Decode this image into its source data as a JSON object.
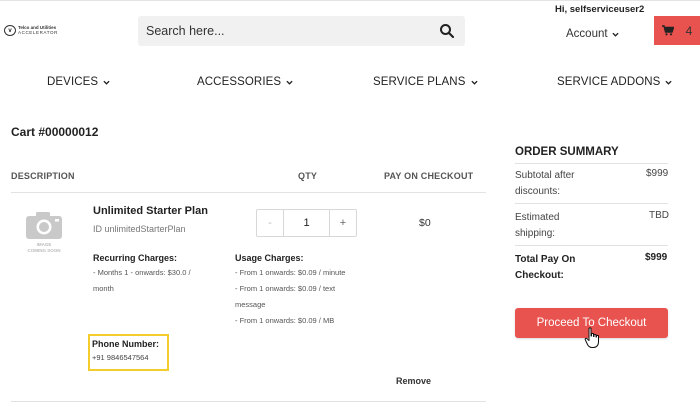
{
  "header": {
    "logo_line1": "Telco and Utilities",
    "logo_line2": "ACCELERATOR",
    "search_placeholder": "Search here...",
    "greeting": "Hi, selfserviceuser2",
    "account_label": "Account",
    "cart_count": "4",
    "accent_color": "#e8534f"
  },
  "nav": [
    "DEVICES",
    "ACCESSORIES",
    "SERVICE PLANS",
    "SERVICE ADDONS"
  ],
  "cart": {
    "title": "Cart #00000012",
    "columns": {
      "description": "DESCRIPTION",
      "qty": "QTY",
      "pay": "PAY ON CHECKOUT"
    },
    "item": {
      "image_caption_1": "IMAGE",
      "image_caption_2": "COMING SOON",
      "name": "Unlimited Starter Plan",
      "id": "ID unlimitedStarterPlan",
      "qty_minus": "-",
      "qty": "1",
      "qty_plus": "+",
      "pay_on_checkout": "$0",
      "recurring_title": "Recurring Charges:",
      "recurring_lines": [
        "- Months 1 - onwards: $30.0 /",
        "month"
      ],
      "usage_title": "Usage Charges:",
      "usage_lines": [
        "- From 1 onwards: $0.09 / minute",
        "- From 1 onwards: $0.09 / text",
        "message",
        "- From 1 onwards: $0.09 / MB"
      ],
      "phone_label": "Phone Number:",
      "phone_value": "+91 9846547564",
      "remove_label": "Remove"
    }
  },
  "order_summary": {
    "title": "ORDER SUMMARY",
    "subtotal_label": "Subtotal after discounts:",
    "subtotal_value": "$999",
    "shipping_label": "Estimated shipping:",
    "shipping_value": "TBD",
    "total_label": "Total Pay On Checkout:",
    "total_value": "$999",
    "checkout_label": "Proceed To Checkout"
  }
}
